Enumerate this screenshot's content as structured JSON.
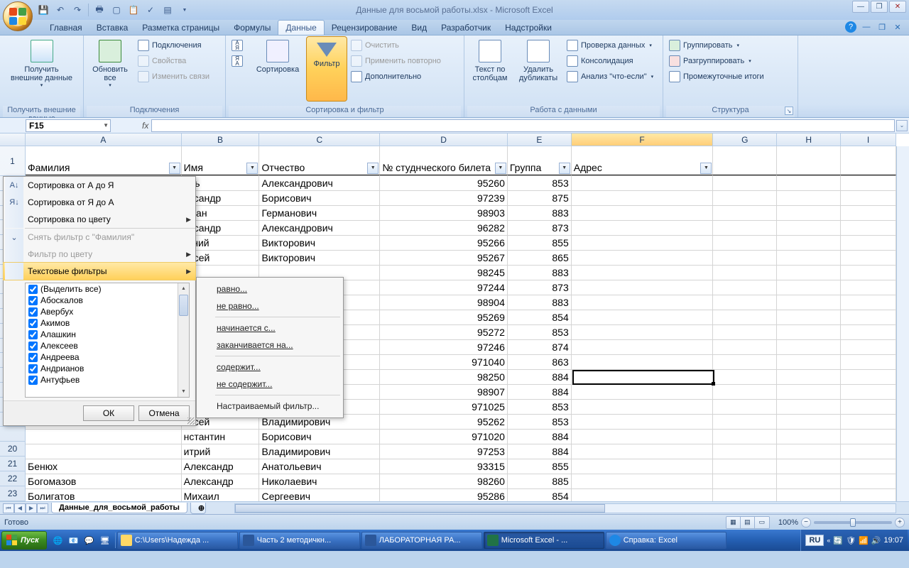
{
  "title": "Данные для восьмой работы.xlsx - Microsoft Excel",
  "qat": {
    "save": "💾",
    "undo": "↶",
    "redo": "↷"
  },
  "tabs": [
    "Главная",
    "Вставка",
    "Разметка страницы",
    "Формулы",
    "Данные",
    "Рецензирование",
    "Вид",
    "Разработчик",
    "Надстройки"
  ],
  "active_tab": 4,
  "ribbon": {
    "g1": {
      "label": "Получить внешние данные",
      "btn": "Получить\nвнешние данные"
    },
    "g2": {
      "label": "Подключения",
      "refresh": "Обновить\nвсе",
      "connections": "Подключения",
      "properties": "Свойства",
      "editlinks": "Изменить связи"
    },
    "g3": {
      "label": "Сортировка и фильтр",
      "az": "А↓Я",
      "za": "Я↓А",
      "sort": "Сортировка",
      "filter": "Фильтр",
      "clear": "Очистить",
      "reapply": "Применить повторно",
      "advanced": "Дополнительно"
    },
    "g4": {
      "label": "Работа с данными",
      "ttc": "Текст по\nстолбцам",
      "dup": "Удалить\nдубликаты",
      "valid": "Проверка данных",
      "consol": "Консолидация",
      "whatif": "Анализ \"что-если\""
    },
    "g5": {
      "label": "Структура",
      "group": "Группировать",
      "ungroup": "Разгруппировать",
      "subtotal": "Промежуточные итоги"
    }
  },
  "namebox": "F15",
  "columns": [
    "A",
    "B",
    "C",
    "D",
    "E",
    "F",
    "G",
    "H",
    "I"
  ],
  "headers": {
    "A": "Фамилия",
    "B": "Имя",
    "C": "Отчество",
    "D": "№ студнческого билета",
    "E": "Группа",
    "F": "Адрес"
  },
  "rows": [
    {
      "n": "",
      "B": "орь",
      "C": "Александрович",
      "D": "95260",
      "E": "853"
    },
    {
      "n": "",
      "B": "ександр",
      "C": "Борисович",
      "D": "97239",
      "E": "875"
    },
    {
      "n": "",
      "B": "рман",
      "C": "Германович",
      "D": "98903",
      "E": "883"
    },
    {
      "n": "",
      "B": "ександр",
      "C": "Александрович",
      "D": "96282",
      "E": "873"
    },
    {
      "n": "",
      "B": "гений",
      "C": "Викторович",
      "D": "95266",
      "E": "855"
    },
    {
      "n": "",
      "B": "ексей",
      "C": "Викторович",
      "D": "95267",
      "E": "865"
    },
    {
      "n": "",
      "B": "",
      "C": "",
      "D": "98245",
      "E": "883"
    },
    {
      "n": "",
      "B": "",
      "C": "",
      "D": "97244",
      "E": "873"
    },
    {
      "n": "",
      "B": "",
      "C": "",
      "D": "98904",
      "E": "883"
    },
    {
      "n": "",
      "B": "",
      "C": "",
      "D": "95269",
      "E": "854"
    },
    {
      "n": "",
      "B": "",
      "C": "",
      "D": "95272",
      "E": "853"
    },
    {
      "n": "",
      "B": "",
      "C": "",
      "D": "97246",
      "E": "874"
    },
    {
      "n": "",
      "B": "",
      "C": "",
      "D": "971040",
      "E": "863"
    },
    {
      "n": "",
      "B": "",
      "C": "",
      "D": "98250",
      "E": "884"
    },
    {
      "n": "",
      "B": "",
      "C": "",
      "D": "98907",
      "E": "884"
    },
    {
      "n": "",
      "B": "",
      "C": "",
      "D": "971025",
      "E": "853"
    },
    {
      "n": "",
      "B": "ексей",
      "C": "Владимирович",
      "D": "95262",
      "E": "853"
    },
    {
      "n": "",
      "B": "нстантин",
      "C": "Борисович",
      "D": "971020",
      "E": "884"
    },
    {
      "n": "20",
      "B": "итрий",
      "C": "Владимирович",
      "D": "97253",
      "E": "884"
    },
    {
      "n": "21",
      "A": "Бенюх",
      "B": "Александр",
      "C": "Анатольевич",
      "D": "93315",
      "E": "855"
    },
    {
      "n": "22",
      "A": "Богомазов",
      "B": "Александр",
      "C": "Николаевич",
      "D": "98260",
      "E": "885"
    },
    {
      "n": "23",
      "A": "Болигатов",
      "B": "Михаил",
      "C": "Сергеевич",
      "D": "95286",
      "E": "854"
    }
  ],
  "row_numbers_visible": [
    "1",
    "",
    "",
    "",
    "",
    "",
    "",
    "",
    "",
    "",
    "",
    "",
    "",
    "",
    "",
    "",
    "",
    "",
    "",
    "20",
    "21",
    "22",
    "23"
  ],
  "filter_menu": {
    "sort_az": "Сортировка от А до Я",
    "sort_za": "Сортировка от Я до А",
    "sort_color": "Сортировка по цвету",
    "clear": "Снять фильтр с \"Фамилия\"",
    "color": "Фильтр по цвету",
    "text": "Текстовые фильтры",
    "select_all": "(Выделить все)",
    "items": [
      "Абоскалов",
      "Авербух",
      "Акимов",
      "Алашкин",
      "Алексеев",
      "Андреева",
      "Андрианов",
      "Антуфьев"
    ],
    "ok": "ОК",
    "cancel": "Отмена"
  },
  "submenu": {
    "equals": "равно...",
    "not_equals": "не равно...",
    "begins": "начинается с...",
    "ends": "заканчивается на...",
    "contains": "содержит...",
    "not_contains": "не содержит...",
    "custom": "Настраиваемый фильтр..."
  },
  "sheet_tab": "Данные_для_восьмой_работы",
  "status": "Готово",
  "zoom": "100%",
  "taskbar": {
    "start": "Пуск",
    "tasks": [
      "C:\\Users\\Надежда ...",
      "Часть 2 методичкн...",
      "ЛАБОРАТОРНАЯ РА...",
      "Microsoft Excel - ...",
      "Справка: Excel"
    ],
    "active_task": 3,
    "lang": "RU",
    "time": "19:07"
  }
}
